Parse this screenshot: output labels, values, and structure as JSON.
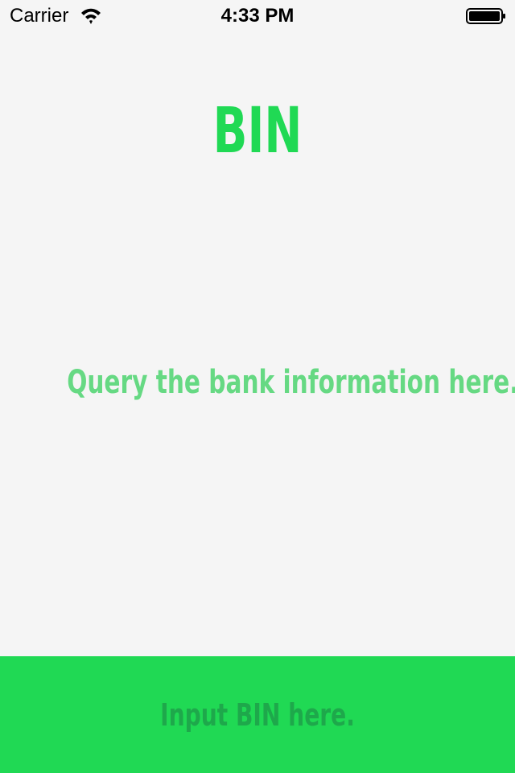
{
  "status_bar": {
    "carrier": "Carrier",
    "time": "4:33 PM",
    "wifi_icon": "wifi-icon",
    "battery_icon": "battery-icon"
  },
  "main": {
    "title": "BIN",
    "message": "Query the bank information here."
  },
  "input": {
    "placeholder": "Input BIN here.",
    "value": ""
  },
  "colors": {
    "background": "#f5f5f5",
    "accent": "#20d954",
    "message_text": "#66d983",
    "placeholder_text": "#1ea84b"
  }
}
